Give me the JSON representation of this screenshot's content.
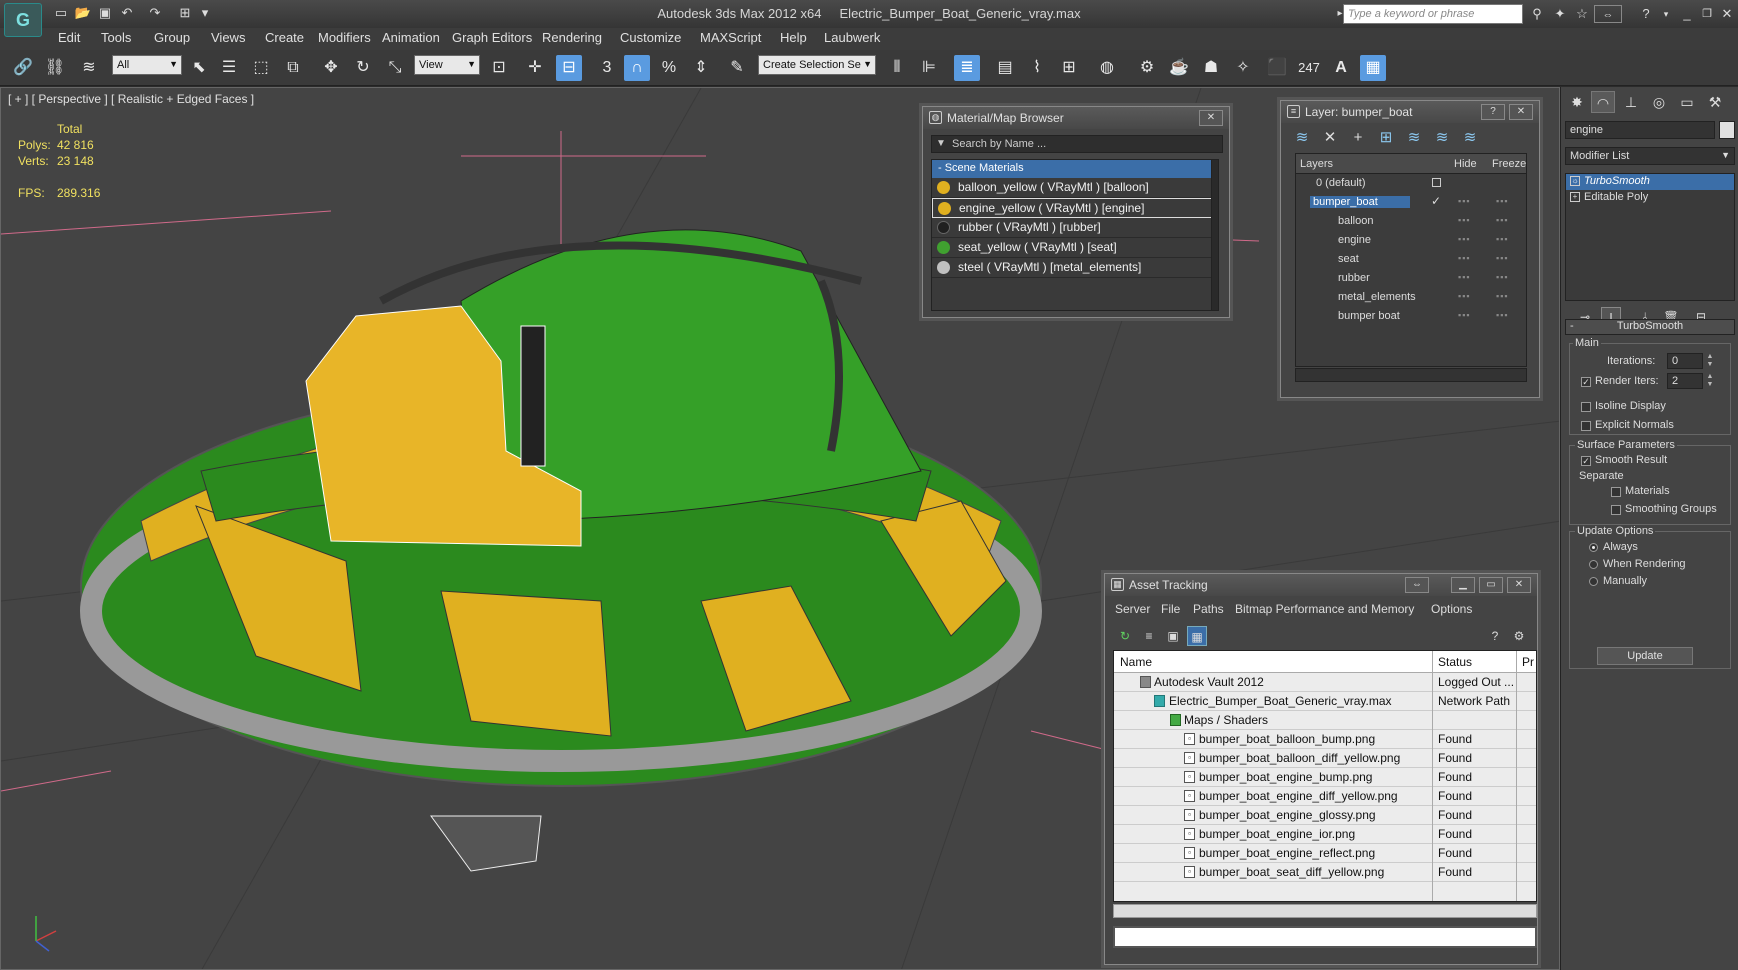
{
  "app": {
    "title": "Autodesk 3ds Max  2012 x64",
    "file": "Electric_Bumper_Boat_Generic_vray.max",
    "logo": "G",
    "search_placeholder": "Type a keyword or phrase"
  },
  "menu": [
    "Edit",
    "Tools",
    "Group",
    "Views",
    "Create",
    "Modifiers",
    "Animation",
    "Graph Editors",
    "Rendering",
    "Customize",
    "MAXScript",
    "Help",
    "Laubwerk"
  ],
  "toolbar": {
    "selection_filter": "All",
    "ref_coord": "View",
    "named_selection": "Create Selection Se",
    "counter": "247"
  },
  "viewport": {
    "label": "[ + ] [ Perspective ] [ Realistic + Edged Faces ]",
    "stats": {
      "total_label": "Total",
      "polys_label": "Polys:",
      "polys": "42 816",
      "verts_label": "Verts:",
      "verts": "23 148",
      "fps_label": "FPS:",
      "fps": "289.316"
    }
  },
  "material_browser": {
    "title": "Material/Map Browser",
    "search_placeholder": "Search by Name ...",
    "section": "- Scene Materials",
    "items": [
      {
        "label": "balloon_yellow  ( VRayMtl ) [balloon]",
        "color": "#e0b020"
      },
      {
        "label": "engine_yellow  ( VRayMtl ) [engine]",
        "color": "#e0b020"
      },
      {
        "label": "rubber  ( VRayMtl ) [rubber]",
        "color": "#202020"
      },
      {
        "label": "seat_yellow  ( VRayMtl ) [seat]",
        "color": "#40a030"
      },
      {
        "label": "steel  ( VRayMtl ) [metal_elements]",
        "color": "#c0c0c0"
      }
    ]
  },
  "layers": {
    "title": "Layer: bumper_boat",
    "col_layers": "Layers",
    "col_hide": "Hide",
    "col_freeze": "Freeze",
    "items": [
      {
        "name": "0 (default)",
        "indent": 0
      },
      {
        "name": "bumper_boat",
        "indent": 0
      },
      {
        "name": "balloon",
        "indent": 1
      },
      {
        "name": "engine",
        "indent": 1
      },
      {
        "name": "seat",
        "indent": 1
      },
      {
        "name": "rubber",
        "indent": 1
      },
      {
        "name": "metal_elements",
        "indent": 1
      },
      {
        "name": "bumper boat",
        "indent": 1
      }
    ]
  },
  "command_panel": {
    "object_name": "engine",
    "modifier_list": "Modifier List",
    "stack": [
      "TurboSmooth",
      "Editable Poly"
    ],
    "rollout_title": "TurboSmooth",
    "main_label": "Main",
    "iterations_label": "Iterations:",
    "iterations": "0",
    "render_iters_label": "Render Iters:",
    "render_iters": "2",
    "isoline": "Isoline Display",
    "explicit_normals": "Explicit Normals",
    "surface_params": "Surface Parameters",
    "smooth_result": "Smooth Result",
    "separate": "Separate",
    "materials": "Materials",
    "smoothing_groups": "Smoothing Groups",
    "update_options": "Update Options",
    "always": "Always",
    "when_rendering": "When Rendering",
    "manually": "Manually",
    "update_button": "Update"
  },
  "asset_tracking": {
    "title": "Asset Tracking",
    "menu": [
      "Server",
      "File",
      "Paths",
      "Bitmap Performance and Memory",
      "Options"
    ],
    "col_name": "Name",
    "col_status": "Status",
    "col_pr": "Pr",
    "rows": [
      {
        "name": "Autodesk Vault 2012",
        "status": "Logged Out ...",
        "indent": 1
      },
      {
        "name": "Electric_Bumper_Boat_Generic_vray.max",
        "status": "Network Path",
        "indent": 2
      },
      {
        "name": "Maps / Shaders",
        "status": "",
        "indent": 3
      },
      {
        "name": "bumper_boat_balloon_bump.png",
        "status": "Found",
        "indent": 4
      },
      {
        "name": "bumper_boat_balloon_diff_yellow.png",
        "status": "Found",
        "indent": 4
      },
      {
        "name": "bumper_boat_engine_bump.png",
        "status": "Found",
        "indent": 4
      },
      {
        "name": "bumper_boat_engine_diff_yellow.png",
        "status": "Found",
        "indent": 4
      },
      {
        "name": "bumper_boat_engine_glossy.png",
        "status": "Found",
        "indent": 4
      },
      {
        "name": "bumper_boat_engine_ior.png",
        "status": "Found",
        "indent": 4
      },
      {
        "name": "bumper_boat_engine_reflect.png",
        "status": "Found",
        "indent": 4
      },
      {
        "name": "bumper_boat_seat_diff_yellow.png",
        "status": "Found",
        "indent": 4
      }
    ]
  }
}
